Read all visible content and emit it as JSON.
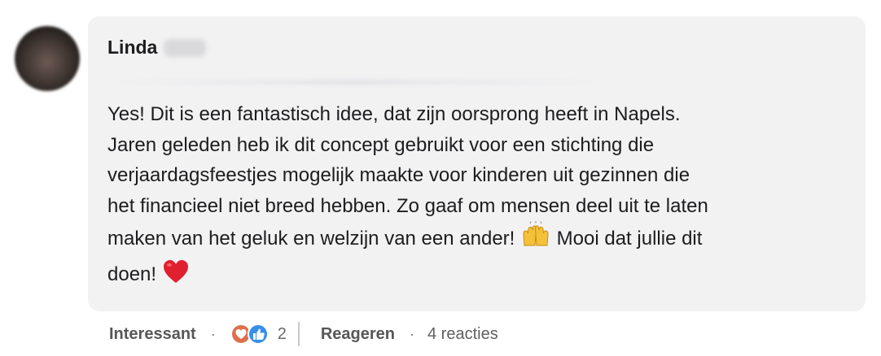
{
  "comment": {
    "author": "Linda",
    "text_lines": [
      "Yes! Dit is een fantastisch idee, dat zijn oorsprong heeft in Napels.",
      "Jaren geleden heb ik dit concept gebruikt voor een stichting die",
      "verjaardagsfeestjes mogelijk maakte voor kinderen uit gezinnen die",
      "het financieel niet breed hebben. Zo gaaf om mensen deel uit te laten",
      "maken van het geluk en welzijn van een ander!",
      "Mooi dat jullie dit",
      "doen!"
    ]
  },
  "actions": {
    "like_label": "Interessant",
    "separator": "·",
    "reaction_count": "2",
    "reply_label": "Reageren",
    "replies_count": "4 reacties"
  },
  "icons": {
    "avatar": "profile-photo",
    "raised_hands": "raised-hands-emoji",
    "heart": "red-heart-emoji",
    "reactions": [
      "love-reaction-icon",
      "like-reaction-icon"
    ]
  },
  "colors": {
    "bubble": "#f2f2f3",
    "text": "#1d1d1f",
    "muted": "#5f5f62",
    "like_blue": "#378fe9",
    "love_red": "#df704d",
    "heart": "#e0202e"
  }
}
